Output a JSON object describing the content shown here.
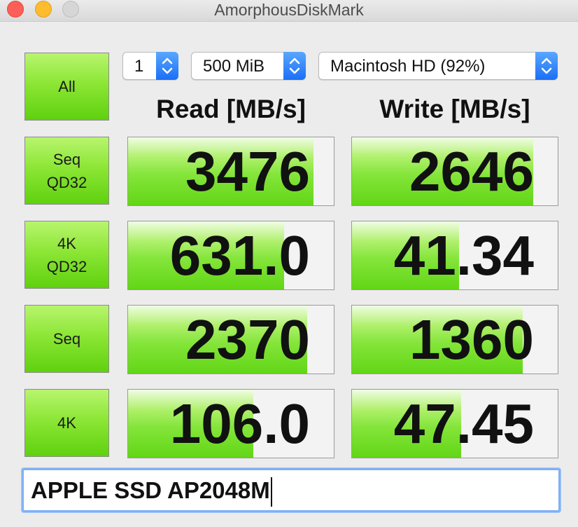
{
  "window": {
    "title": "AmorphousDiskMark"
  },
  "controls": {
    "all_label": "All",
    "count": {
      "value": "1"
    },
    "size": {
      "value": "500 MiB"
    },
    "target": {
      "value": "Macintosh HD (92%)"
    }
  },
  "headers": {
    "read": "Read [MB/s]",
    "write": "Write [MB/s]"
  },
  "tests": [
    {
      "label_line1": "Seq",
      "label_line2": "QD32",
      "read": "3476",
      "write": "2646",
      "read_fill_pct": 90,
      "write_fill_pct": 88
    },
    {
      "label_line1": "4K",
      "label_line2": "QD32",
      "read": "631.0",
      "write": "41.34",
      "read_fill_pct": 76,
      "write_fill_pct": 52
    },
    {
      "label_line1": "Seq",
      "label_line2": "",
      "read": "2370",
      "write": "1360",
      "read_fill_pct": 87,
      "write_fill_pct": 83
    },
    {
      "label_line1": "4K",
      "label_line2": "",
      "read": "106.0",
      "write": "47.45",
      "read_fill_pct": 61,
      "write_fill_pct": 53
    }
  ],
  "drive_name": "APPLE SSD AP2048M",
  "colors": {
    "accent_green": "#7fe22e",
    "stepper_blue": "#2a7ff7",
    "focus_ring": "#7fb1f5"
  }
}
